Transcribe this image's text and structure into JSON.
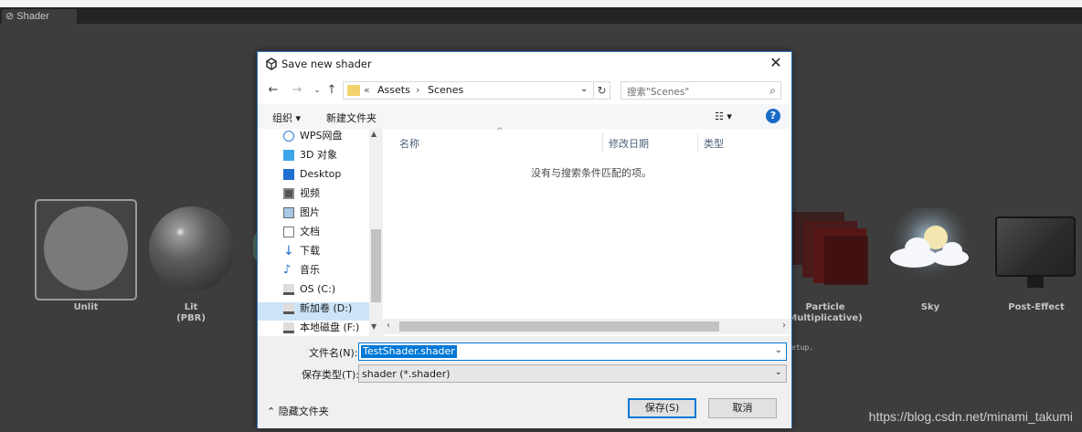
{
  "app": {
    "tab_title": "Shader Forge"
  },
  "shader_types": {
    "unlit": "Unlit",
    "lit": "Lit",
    "lit_sub": "(PBR)",
    "particle": "Particle",
    "particle_sub": "Multiplicative)",
    "sky": "Sky",
    "post_effect": "Post-Effect",
    "setup_fragment": "etup."
  },
  "watermark": "https://blog.csdn.net/minami_takumi",
  "dialog": {
    "title": "Save new shader",
    "close": "✕",
    "breadcrumb": {
      "prefix": "«",
      "parts": [
        "Assets",
        "Scenes"
      ]
    },
    "search_placeholder": "搜索\"Scenes\"",
    "toolbar": {
      "organize": "组织 ▾",
      "new_folder": "新建文件夹",
      "view": "☷ ▾",
      "help": "?"
    },
    "nav_items": [
      {
        "label": "WPS网盘",
        "icon": "cloud-icon"
      },
      {
        "label": "3D 对象",
        "icon": "cube-icon"
      },
      {
        "label": "Desktop",
        "icon": "desktop-icon"
      },
      {
        "label": "视频",
        "icon": "video-icon"
      },
      {
        "label": "图片",
        "icon": "picture-icon"
      },
      {
        "label": "文档",
        "icon": "document-icon"
      },
      {
        "label": "下载",
        "icon": "download-icon"
      },
      {
        "label": "音乐",
        "icon": "music-icon"
      },
      {
        "label": "OS (C:)",
        "icon": "drive-icon"
      },
      {
        "label": "新加卷 (D:)",
        "icon": "drive-icon"
      },
      {
        "label": "本地磁盘 (F:)",
        "icon": "drive-icon"
      }
    ],
    "columns": [
      "名称",
      "修改日期",
      "类型"
    ],
    "empty_message": "没有与搜索条件匹配的项。",
    "filename_label": "文件名(N):",
    "filename_value": "TestShader.shader",
    "filetype_label": "保存类型(T):",
    "filetype_value": "shader (*.shader)",
    "hide_folders": "隐藏文件夹",
    "save_button": "保存(S)",
    "cancel_button": "取消"
  }
}
